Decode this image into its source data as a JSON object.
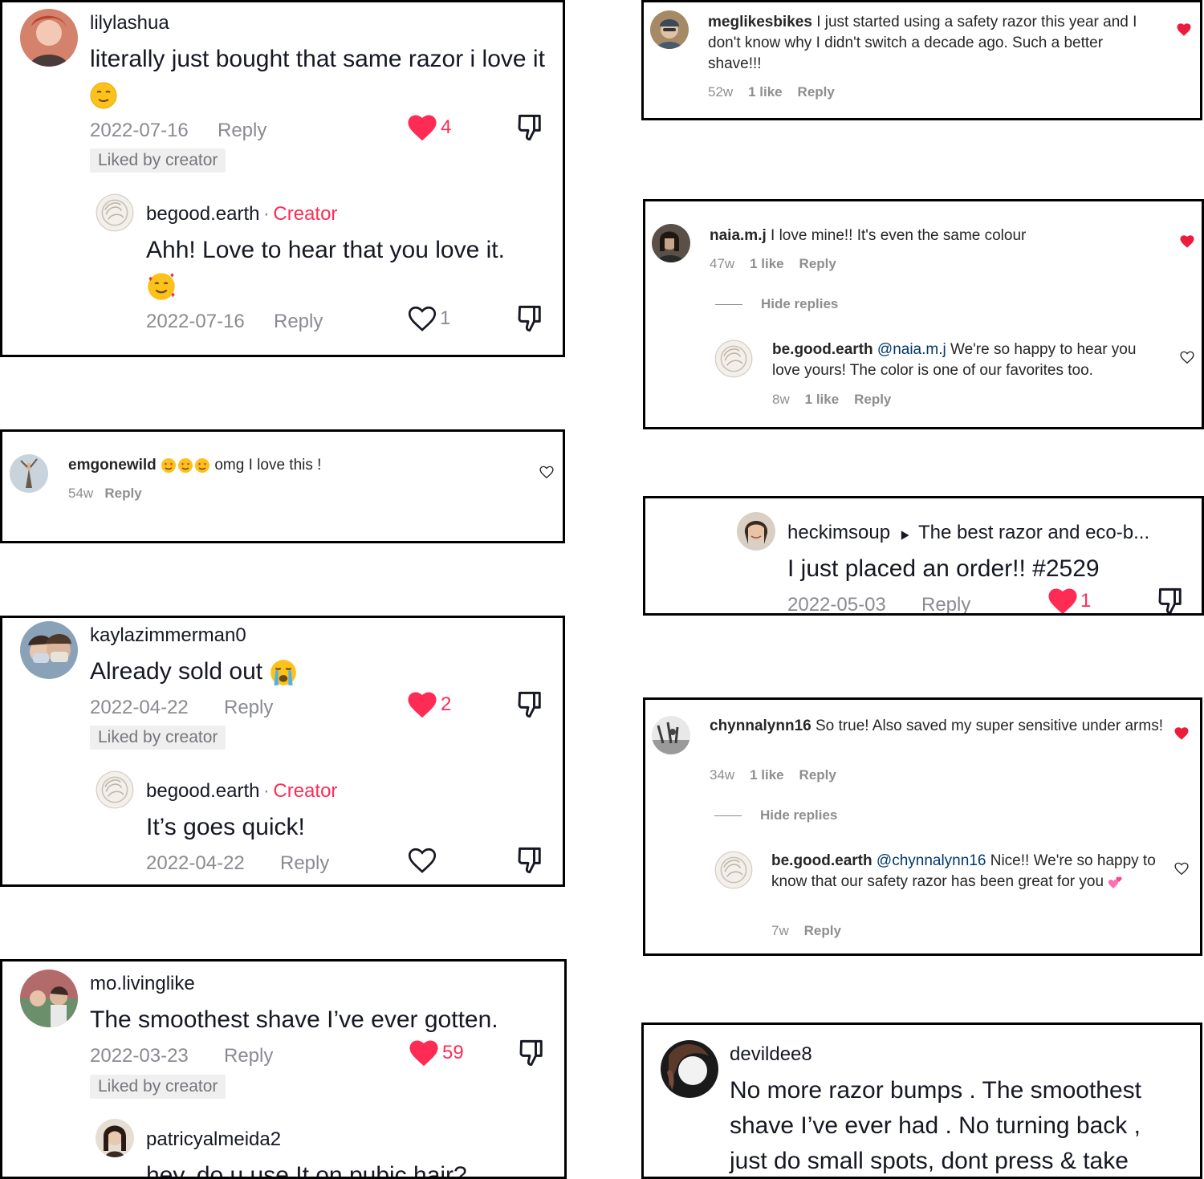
{
  "card_tl1": {
    "user": "lilylashua",
    "text": "literally just bought that same razor i love it",
    "date": "2022-07-16",
    "reply": "Reply",
    "likes": "4",
    "badge": "Liked by creator",
    "sub": {
      "user": "begood.earth",
      "sep": "·",
      "creator": "Creator",
      "text": "Ahh! Love to hear that you love it.",
      "date": "2022-07-16",
      "reply": "Reply",
      "likes": "1"
    }
  },
  "card_tl2": {
    "user": "emgonewild",
    "text": "omg I love this !",
    "time": "54w",
    "reply": "Reply"
  },
  "card_tl3": {
    "user": "kaylazimmerman0",
    "text": "Already sold out",
    "date": "2022-04-22",
    "reply": "Reply",
    "likes": "2",
    "badge": "Liked by creator",
    "sub": {
      "user": "begood.earth",
      "sep": "·",
      "creator": "Creator",
      "text": "It’s goes quick!",
      "date": "2022-04-22",
      "reply": "Reply"
    }
  },
  "card_tl4": {
    "user": "mo.livinglike",
    "text": "The smoothest shave I’ve ever gotten.",
    "date": "2022-03-23",
    "reply": "Reply",
    "likes": "59",
    "badge": "Liked by creator",
    "sub": {
      "user": "patricyalmeida2",
      "text": "hey, do u use It on pubic hair?"
    }
  },
  "card_r1": {
    "user": "meglikesbikes",
    "text": "I just started using a safety razor this year and I don't know why I didn't switch a decade ago. Such a better shave!!!",
    "time": "52w",
    "likes": "1 like",
    "reply": "Reply"
  },
  "card_r2": {
    "user": "naia.m.j",
    "text": "I love mine!! It's even the same colour",
    "time": "47w",
    "likes": "1 like",
    "reply": "Reply",
    "hide": "Hide replies",
    "sub": {
      "user": "be.good.earth",
      "mention": "@naia.m.j",
      "text": "We're so happy to hear you love yours! The color is one of our favorites too.",
      "time": "8w",
      "likes": "1 like",
      "reply": "Reply"
    }
  },
  "card_r3": {
    "user": "heckimsoup",
    "video_title": "The best razor and eco-b...",
    "text": "I just placed an order!! #2529",
    "date": "2022-05-03",
    "reply": "Reply",
    "likes": "1"
  },
  "card_r4": {
    "user": "chynnalynn16",
    "text": "So true! Also saved my super sensitive under arms!",
    "time": "34w",
    "likes": "1 like",
    "reply": "Reply",
    "hide": "Hide replies",
    "sub": {
      "user": "be.good.earth",
      "mention": "@chynnalynn16",
      "text": "Nice!! We're so happy to know that our safety razor has been great for you",
      "time": "7w",
      "reply": "Reply"
    }
  },
  "card_r5": {
    "user": "devildee8",
    "text": "No more razor bumps . The smoothest shave I’ve ever had . No turning back , just do small spots, dont press & take"
  },
  "colors": {
    "tiktok_red": "#fe2c55",
    "ig_heart": "#ed1c3c",
    "text_dark": "#161823",
    "text_grey": "#8a8b91",
    "ig_mention": "#00376b"
  }
}
